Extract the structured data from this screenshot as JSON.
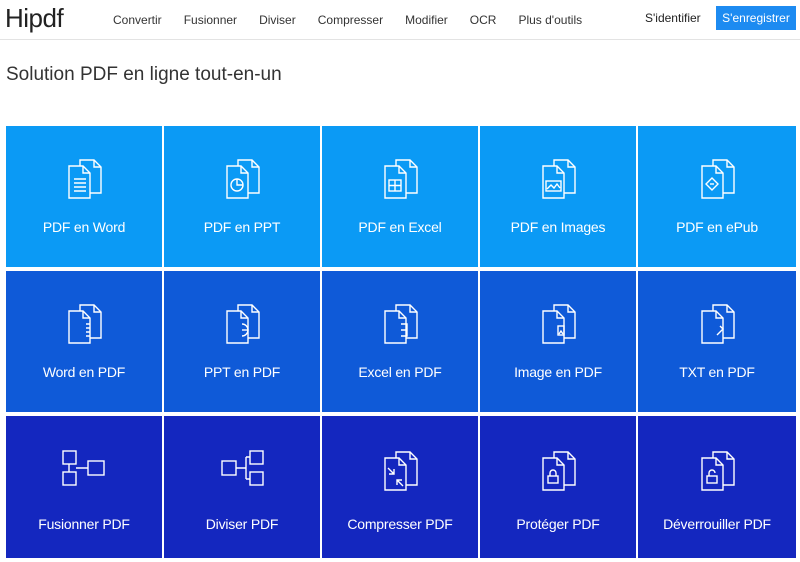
{
  "header": {
    "logo": "Hipdf",
    "nav": [
      "Convertir",
      "Fusionner",
      "Diviser",
      "Compresser",
      "Modifier",
      "OCR",
      "Plus d'outils"
    ],
    "login_label": "S'identifier",
    "register_label": "S'enregistrer"
  },
  "page_title": "Solution PDF en ligne tout-en-un",
  "colors": {
    "accent": "#1d8bf1",
    "row1": "#0b9af5",
    "row2": "#0f5ad8",
    "row3": "#1427bf"
  },
  "tools": [
    [
      {
        "label": "PDF en Word",
        "icon": "pdf-to-word-icon"
      },
      {
        "label": "PDF en PPT",
        "icon": "pdf-to-ppt-icon"
      },
      {
        "label": "PDF en Excel",
        "icon": "pdf-to-excel-icon"
      },
      {
        "label": "PDF en Images",
        "icon": "pdf-to-image-icon"
      },
      {
        "label": "PDF en ePub",
        "icon": "pdf-to-epub-icon"
      }
    ],
    [
      {
        "label": "Word en PDF",
        "icon": "word-to-pdf-icon"
      },
      {
        "label": "PPT en PDF",
        "icon": "ppt-to-pdf-icon"
      },
      {
        "label": "Excel en PDF",
        "icon": "excel-to-pdf-icon"
      },
      {
        "label": "Image en PDF",
        "icon": "image-to-pdf-icon"
      },
      {
        "label": "TXT en PDF",
        "icon": "txt-to-pdf-icon"
      }
    ],
    [
      {
        "label": "Fusionner PDF",
        "icon": "merge-icon"
      },
      {
        "label": "Diviser PDF",
        "icon": "split-icon"
      },
      {
        "label": "Compresser PDF",
        "icon": "compress-icon"
      },
      {
        "label": "Protéger PDF",
        "icon": "lock-icon"
      },
      {
        "label": "Déverrouiller PDF",
        "icon": "unlock-icon"
      }
    ]
  ]
}
